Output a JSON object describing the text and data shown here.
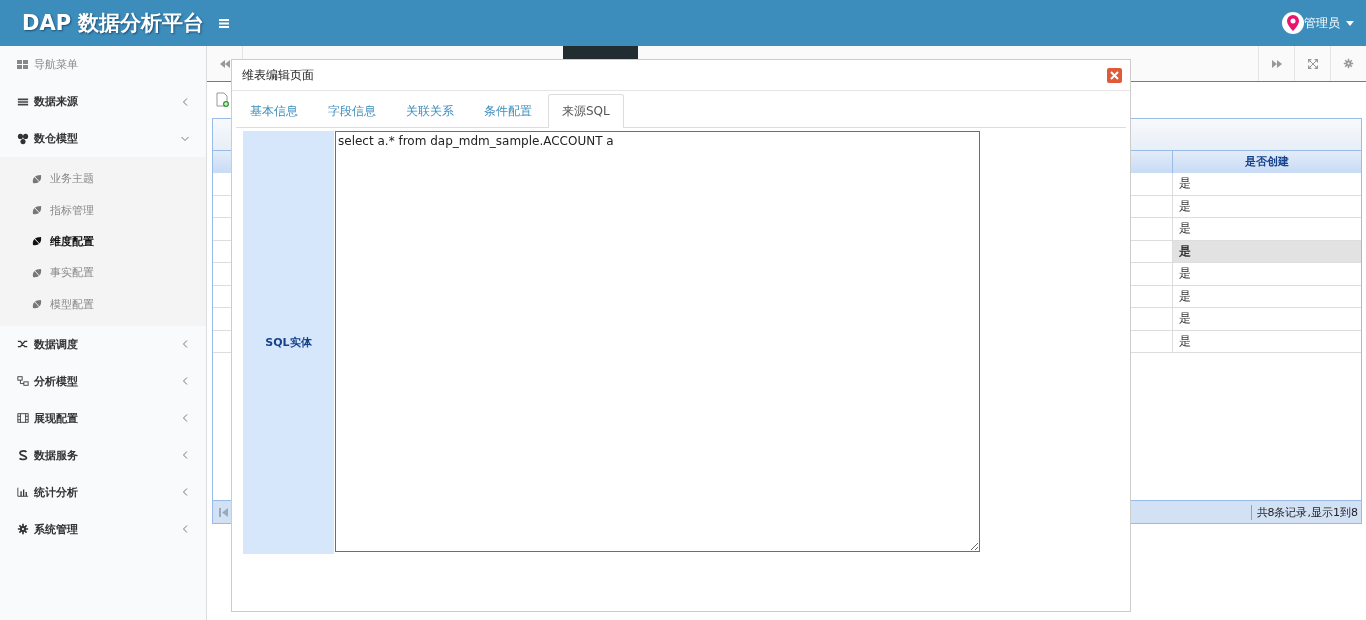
{
  "header": {
    "logo": "DAP 数据分析平台",
    "user": "管理员"
  },
  "sidebar": {
    "title": "导航菜单",
    "items": [
      {
        "label": "数据来源",
        "expanded": false
      },
      {
        "label": "数仓模型",
        "expanded": true,
        "children": [
          {
            "label": "业务主题",
            "selected": false
          },
          {
            "label": "指标管理",
            "selected": false
          },
          {
            "label": "维度配置",
            "selected": true
          },
          {
            "label": "事实配置",
            "selected": false
          },
          {
            "label": "模型配置",
            "selected": false
          }
        ]
      },
      {
        "label": "数据调度",
        "expanded": false
      },
      {
        "label": "分析模型",
        "expanded": false
      },
      {
        "label": "展现配置",
        "expanded": false
      },
      {
        "label": "数据服务",
        "expanded": false
      },
      {
        "label": "统计分析",
        "expanded": false
      },
      {
        "label": "系统管理",
        "expanded": false
      }
    ]
  },
  "table": {
    "columns": [
      {
        "label": "是否创建"
      }
    ],
    "rows": [
      {
        "cells": [
          "是"
        ],
        "selected": false
      },
      {
        "cells": [
          "是"
        ],
        "selected": false
      },
      {
        "cells": [
          "是"
        ],
        "selected": false
      },
      {
        "cells": [
          "是"
        ],
        "selected": true
      },
      {
        "cells": [
          "是"
        ],
        "selected": false
      },
      {
        "cells": [
          "是"
        ],
        "selected": false
      },
      {
        "cells": [
          "是"
        ],
        "selected": false
      },
      {
        "cells": [
          "是"
        ],
        "selected": false
      }
    ],
    "pager": {
      "summary": "共8条记录,显示1到8"
    }
  },
  "dialog": {
    "title": "维表编辑页面",
    "tabs": [
      {
        "label": "基本信息",
        "selected": false
      },
      {
        "label": "字段信息",
        "selected": false
      },
      {
        "label": "关联关系",
        "selected": false
      },
      {
        "label": "条件配置",
        "selected": false
      },
      {
        "label": "来源SQL",
        "selected": true
      }
    ],
    "form": {
      "label": "SQL实体",
      "value": "select a.* from dap_mdm_sample.ACCOUNT a"
    }
  }
}
